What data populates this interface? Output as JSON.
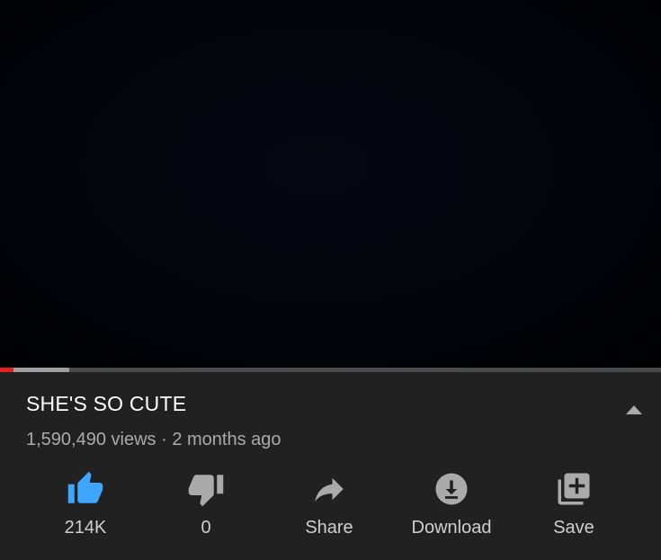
{
  "video": {
    "progress_played_fraction": 0.02,
    "progress_buffered_fraction": 0.105
  },
  "details": {
    "title": "SHE'S SO CUTE",
    "views": "1,590,490 views",
    "separator": " · ",
    "age": "2 months ago"
  },
  "actions": [
    {
      "label": "214K",
      "icon": "thumbs-up-icon",
      "active": true
    },
    {
      "label": "0",
      "icon": "thumbs-down-icon",
      "active": false
    },
    {
      "label": "Share",
      "icon": "share-icon",
      "active": false
    },
    {
      "label": "Download",
      "icon": "download-icon",
      "active": false
    },
    {
      "label": "Save",
      "icon": "playlist-add-icon",
      "active": false
    }
  ],
  "colors": {
    "accent_blue": "#3ea6ff",
    "progress_red": "#e62117",
    "icon_gray": "#aaaaaa",
    "background": "#212121"
  }
}
